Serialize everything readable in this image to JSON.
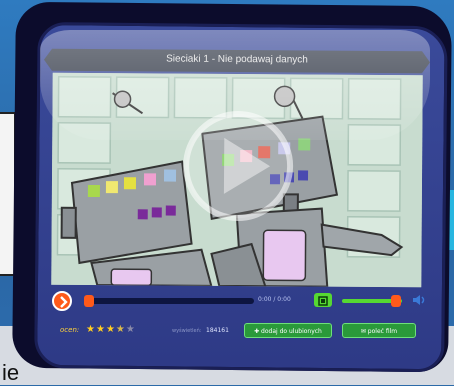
{
  "player": {
    "title": "Sieciaki 1 - Nie podawaj danych",
    "time": "0:00 / 0:00",
    "rating_label": "ocen:",
    "rating_stars": 3.5,
    "rating_max": 5,
    "views_label": "wyświetleń:",
    "views": "184161",
    "add_fav_label": "✚ dodaj do ulubionych",
    "recommend_label": "✉ poleć film",
    "volume_level": 0.9,
    "progress": 0
  },
  "background": {
    "bottom_text": "ie"
  },
  "icons": {
    "play": "play-icon",
    "fullscreen": "fullscreen-icon",
    "volume": "speaker-icon"
  },
  "colors": {
    "accent": "#ff5a1a",
    "green": "#56d832",
    "frame": "#0c0c2c",
    "screen": "#2e3a86"
  }
}
